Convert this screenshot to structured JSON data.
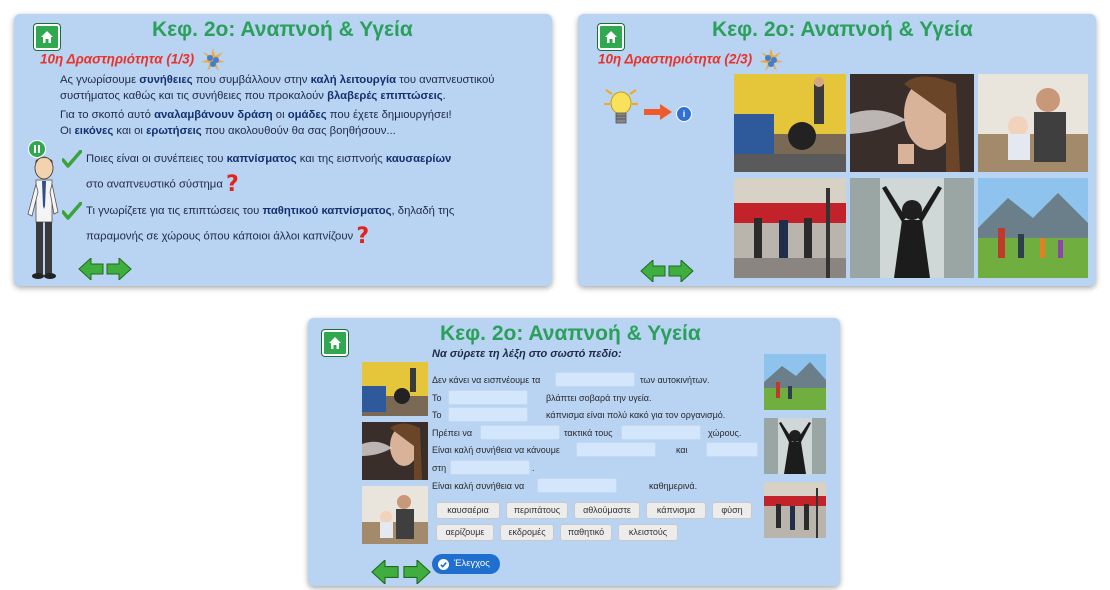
{
  "slides": [
    {
      "title": "Κεφ. 2ο: Αναπνοή & Υγεία",
      "subtitle": "10η Δραστηριότητα (1/3)",
      "intro": {
        "l1a": "Ας γνωρίσουμε ",
        "l1b": "συνήθειες",
        "l1c": " που συμβάλλουν στην ",
        "l1d": "καλή λειτουργία",
        "l1e": " του αναπνευστικού",
        "l2a": "συστήματος καθώς και τις συνήθειες που προκαλούν ",
        "l2b": "βλαβερές επιπτώσεις",
        "l2c": ".",
        "l3a": "Για το σκοπό αυτό ",
        "l3b": "αναλαμβάνουν δράση",
        "l3c": " οι ",
        "l3d": "ομάδες",
        "l3e": " που έχετε δημιουργήσει!",
        "l4a": "Οι ",
        "l4b": "εικόνες",
        "l4c": " και οι ",
        "l4d": "ερωτήσεις",
        "l4e": " που ακολουθούν θα σας βοηθήσουν..."
      },
      "q1": {
        "a": "Ποιες είναι οι συνέπειες του ",
        "b": "καπνίσματος",
        "c": " και της εισπνοής ",
        "d": "καυσαερίων",
        "e": "στο αναπνευστικό σύστημα"
      },
      "q2": {
        "a": "Τι γνωρίζετε για τις επιπτώσεις του ",
        "b": "παθητικού καπνίσματος",
        "c": ", δηλαδή της",
        "d": "παραμονής σε χώρους όπου κάποιοι άλλοι καπνίζουν"
      },
      "question_mark": "?"
    },
    {
      "title": "Κεφ. 2ο: Αναπνοή & Υγεία",
      "subtitle": "10η Δραστηριότητα (2/3)",
      "info_icon": "info-icon",
      "photos": [
        "car-exhaust-photo",
        "woman-smoking-photo",
        "man-smoking-with-baby-photo",
        "people-walking-city-photo",
        "girl-at-window-photo",
        "family-hiking-photo"
      ]
    },
    {
      "title": "Κεφ. 2ο: Αναπνοή & Υγεία",
      "instruction": "Να σύρετε τη λέξη στο σωστό πεδίο:",
      "sentences": {
        "s1a": "Δεν κάνει να εισπνέουμε τα",
        "s1b": "των αυτοκινήτων.",
        "s2a": "Το",
        "s2b": "βλάπτει σοβαρά την υγεία.",
        "s3a": "Το",
        "s3b": "κάπνισμα είναι πολύ κακό για τον οργανισμό.",
        "s4a": "Πρέπει να",
        "s4b": "τακτικά τους",
        "s4c": "χώρους.",
        "s5a": "Είναι καλή συνήθεια να κάνουμε",
        "s5b": "και",
        "s6a": "στη",
        "s6b": ".",
        "s7a": "Είναι καλή συνήθεια να",
        "s7b": "καθημερινά."
      },
      "words": [
        "καυσαέρια",
        "περιπάτους",
        "αθλούμαστε",
        "κάπνισμα",
        "φύση",
        "αερίζουμε",
        "εκδρομές",
        "παθητικό",
        "κλειστούς"
      ],
      "check_label": "Έλεγχος"
    }
  ]
}
